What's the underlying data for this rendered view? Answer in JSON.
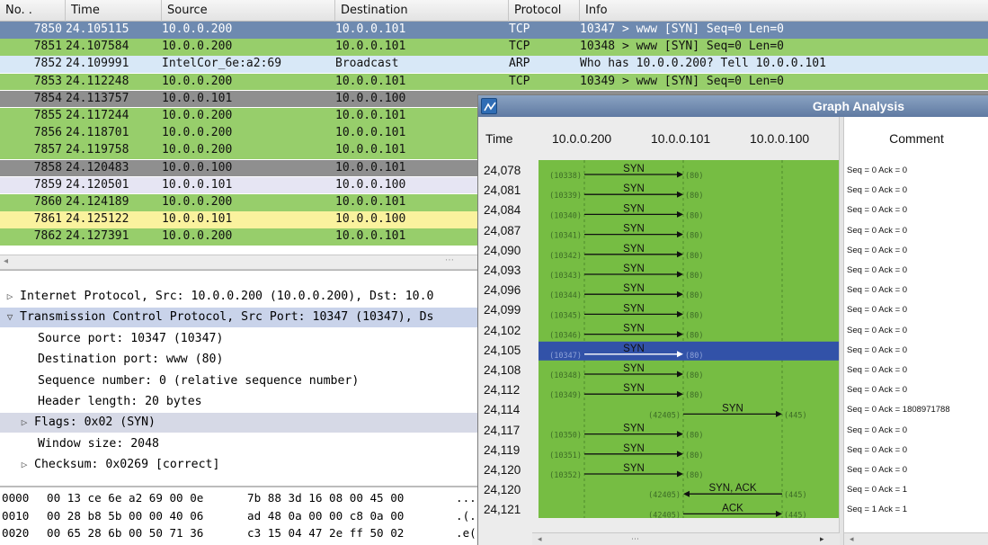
{
  "packet_list": {
    "columns": [
      "No. .",
      "Time",
      "Source",
      "Destination",
      "Protocol",
      "Info"
    ],
    "rows": [
      {
        "no": "7850",
        "time": "24.105115",
        "src": "10.0.0.200",
        "dst": "10.0.0.101",
        "proto": "TCP",
        "info": "10347 > www [SYN] Seq=0 Len=0",
        "bg": "#6e8ab0",
        "fg": "#ffffff"
      },
      {
        "no": "7851",
        "time": "24.107584",
        "src": "10.0.0.200",
        "dst": "10.0.0.101",
        "proto": "TCP",
        "info": "10348 > www [SYN] Seq=0 Len=0",
        "bg": "#97ce6b",
        "fg": "#111111"
      },
      {
        "no": "7852",
        "time": "24.109991",
        "src": "IntelCor_6e:a2:69",
        "dst": "Broadcast",
        "proto": "ARP",
        "info": "Who has 10.0.0.200? Tell 10.0.0.101",
        "bg": "#d8e8f7",
        "fg": "#111111"
      },
      {
        "no": "7853",
        "time": "24.112248",
        "src": "10.0.0.200",
        "dst": "10.0.0.101",
        "proto": "TCP",
        "info": "10349 > www [SYN] Seq=0 Len=0",
        "bg": "#97ce6b",
        "fg": "#111111"
      },
      {
        "no": "7854",
        "time": "24.113757",
        "src": "10.0.0.101",
        "dst": "10.0.0.100",
        "proto": "",
        "info": "",
        "bg": "#8f8f8f",
        "fg": "#111111"
      },
      {
        "no": "7855",
        "time": "24.117244",
        "src": "10.0.0.200",
        "dst": "10.0.0.101",
        "proto": "",
        "info": "",
        "bg": "#97ce6b",
        "fg": "#111111"
      },
      {
        "no": "7856",
        "time": "24.118701",
        "src": "10.0.0.200",
        "dst": "10.0.0.101",
        "proto": "",
        "info": "",
        "bg": "#97ce6b",
        "fg": "#111111"
      },
      {
        "no": "7857",
        "time": "24.119758",
        "src": "10.0.0.200",
        "dst": "10.0.0.101",
        "proto": "",
        "info": "",
        "bg": "#97ce6b",
        "fg": "#111111"
      },
      {
        "no": "7858",
        "time": "24.120483",
        "src": "10.0.0.100",
        "dst": "10.0.0.101",
        "proto": "",
        "info": "",
        "bg": "#8f8f8f",
        "fg": "#111111"
      },
      {
        "no": "7859",
        "time": "24.120501",
        "src": "10.0.0.101",
        "dst": "10.0.0.100",
        "proto": "",
        "info": "",
        "bg": "#e6e5f3",
        "fg": "#111111"
      },
      {
        "no": "7860",
        "time": "24.124189",
        "src": "10.0.0.200",
        "dst": "10.0.0.101",
        "proto": "",
        "info": "",
        "bg": "#97ce6b",
        "fg": "#111111"
      },
      {
        "no": "7861",
        "time": "24.125122",
        "src": "10.0.0.101",
        "dst": "10.0.0.100",
        "proto": "",
        "info": "",
        "bg": "#faf29e",
        "fg": "#111111"
      },
      {
        "no": "7862",
        "time": "24.127391",
        "src": "10.0.0.200",
        "dst": "10.0.0.101",
        "proto": "",
        "info": "",
        "bg": "#97ce6b",
        "fg": "#111111"
      }
    ]
  },
  "details": {
    "rows": [
      {
        "indent": 0,
        "tri": "▷",
        "text": "Internet Protocol, Src: 10.0.0.200 (10.0.0.200), Dst: 10.0",
        "style": "plain"
      },
      {
        "indent": 0,
        "tri": "▽",
        "text": "Transmission Control Protocol, Src Port: 10347 (10347), Ds",
        "style": "hl"
      },
      {
        "indent": 1,
        "tri": "",
        "text": "Source port: 10347 (10347)",
        "style": "plain"
      },
      {
        "indent": 1,
        "tri": "",
        "text": "Destination port: www (80)",
        "style": "plain"
      },
      {
        "indent": 1,
        "tri": "",
        "text": "Sequence number: 0    (relative sequence number)",
        "style": "plain"
      },
      {
        "indent": 1,
        "tri": "",
        "text": "Header length: 20 bytes",
        "style": "plain"
      },
      {
        "indent": 1,
        "tri": "▷",
        "text": "Flags: 0x02 (SYN)",
        "style": "flags"
      },
      {
        "indent": 1,
        "tri": "",
        "text": "Window size: 2048",
        "style": "plain"
      },
      {
        "indent": 1,
        "tri": "▷",
        "text": "Checksum: 0x0269 [correct]",
        "style": "plain"
      }
    ]
  },
  "hex": {
    "rows": [
      {
        "off": "0000",
        "b1": "00 13 ce 6e a2 69 00 0e",
        "b2": "7b 88 3d 16 08 00 45 00",
        "asc": "..."
      },
      {
        "off": "0010",
        "b1": "00 28 b8 5b 00 00 40 06",
        "b2": "ad 48 0a 00 00 c8 0a 00",
        "asc": ".(."
      },
      {
        "off": "0020",
        "b1": "00 65 28 6b 00 50 71 36",
        "b2": "c3 15 04 47 2e ff 50 02",
        "asc": ".e("
      }
    ]
  },
  "graph_analysis": {
    "title": "Graph Analysis",
    "headers": {
      "time": "Time",
      "host1": "10.0.0.200",
      "host2": "10.0.0.101",
      "host3": "10.0.0.100",
      "comment": "Comment"
    },
    "colors": {
      "canvas": "#76bd43",
      "selected": "#3252a8",
      "title_bar": "#6982a8"
    },
    "selected_index": 9,
    "flows": [
      {
        "time": "24,078",
        "from": 0,
        "to": 1,
        "label": "SYN",
        "src_port": "10338",
        "dst_port": "80",
        "comment": "Seq = 0 Ack = 0"
      },
      {
        "time": "24,081",
        "from": 0,
        "to": 1,
        "label": "SYN",
        "src_port": "10339",
        "dst_port": "80",
        "comment": "Seq = 0 Ack = 0"
      },
      {
        "time": "24,084",
        "from": 0,
        "to": 1,
        "label": "SYN",
        "src_port": "10340",
        "dst_port": "80",
        "comment": "Seq = 0 Ack = 0"
      },
      {
        "time": "24,087",
        "from": 0,
        "to": 1,
        "label": "SYN",
        "src_port": "10341",
        "dst_port": "80",
        "comment": "Seq = 0 Ack = 0"
      },
      {
        "time": "24,090",
        "from": 0,
        "to": 1,
        "label": "SYN",
        "src_port": "10342",
        "dst_port": "80",
        "comment": "Seq = 0 Ack = 0"
      },
      {
        "time": "24,093",
        "from": 0,
        "to": 1,
        "label": "SYN",
        "src_port": "10343",
        "dst_port": "80",
        "comment": "Seq = 0 Ack = 0"
      },
      {
        "time": "24,096",
        "from": 0,
        "to": 1,
        "label": "SYN",
        "src_port": "10344",
        "dst_port": "80",
        "comment": "Seq = 0 Ack = 0"
      },
      {
        "time": "24,099",
        "from": 0,
        "to": 1,
        "label": "SYN",
        "src_port": "10345",
        "dst_port": "80",
        "comment": "Seq = 0 Ack = 0"
      },
      {
        "time": "24,102",
        "from": 0,
        "to": 1,
        "label": "SYN",
        "src_port": "10346",
        "dst_port": "80",
        "comment": "Seq = 0 Ack = 0"
      },
      {
        "time": "24,105",
        "from": 0,
        "to": 1,
        "label": "SYN",
        "src_port": "10347",
        "dst_port": "80",
        "comment": "Seq = 0 Ack = 0"
      },
      {
        "time": "24,108",
        "from": 0,
        "to": 1,
        "label": "SYN",
        "src_port": "10348",
        "dst_port": "80",
        "comment": "Seq = 0 Ack = 0"
      },
      {
        "time": "24,112",
        "from": 0,
        "to": 1,
        "label": "SYN",
        "src_port": "10349",
        "dst_port": "80",
        "comment": "Seq = 0 Ack = 0"
      },
      {
        "time": "24,114",
        "from": 1,
        "to": 2,
        "label": "SYN",
        "src_port": "42405",
        "dst_port": "445",
        "comment": "Seq = 0 Ack = 1808971788"
      },
      {
        "time": "24,117",
        "from": 0,
        "to": 1,
        "label": "SYN",
        "src_port": "10350",
        "dst_port": "80",
        "comment": "Seq = 0 Ack = 0"
      },
      {
        "time": "24,119",
        "from": 0,
        "to": 1,
        "label": "SYN",
        "src_port": "10351",
        "dst_port": "80",
        "comment": "Seq = 0 Ack = 0"
      },
      {
        "time": "24,120",
        "from": 0,
        "to": 1,
        "label": "SYN",
        "src_port": "10352",
        "dst_port": "80",
        "comment": "Seq = 0 Ack = 0"
      },
      {
        "time": "24,120",
        "from": 2,
        "to": 1,
        "label": "SYN, ACK",
        "src_port": "42405",
        "dst_port": "445",
        "comment": "Seq = 0 Ack = 1"
      },
      {
        "time": "24,121",
        "from": 1,
        "to": 2,
        "label": "ACK",
        "src_port": "42405",
        "dst_port": "445",
        "comment": "Seq = 1 Ack = 1"
      }
    ]
  }
}
